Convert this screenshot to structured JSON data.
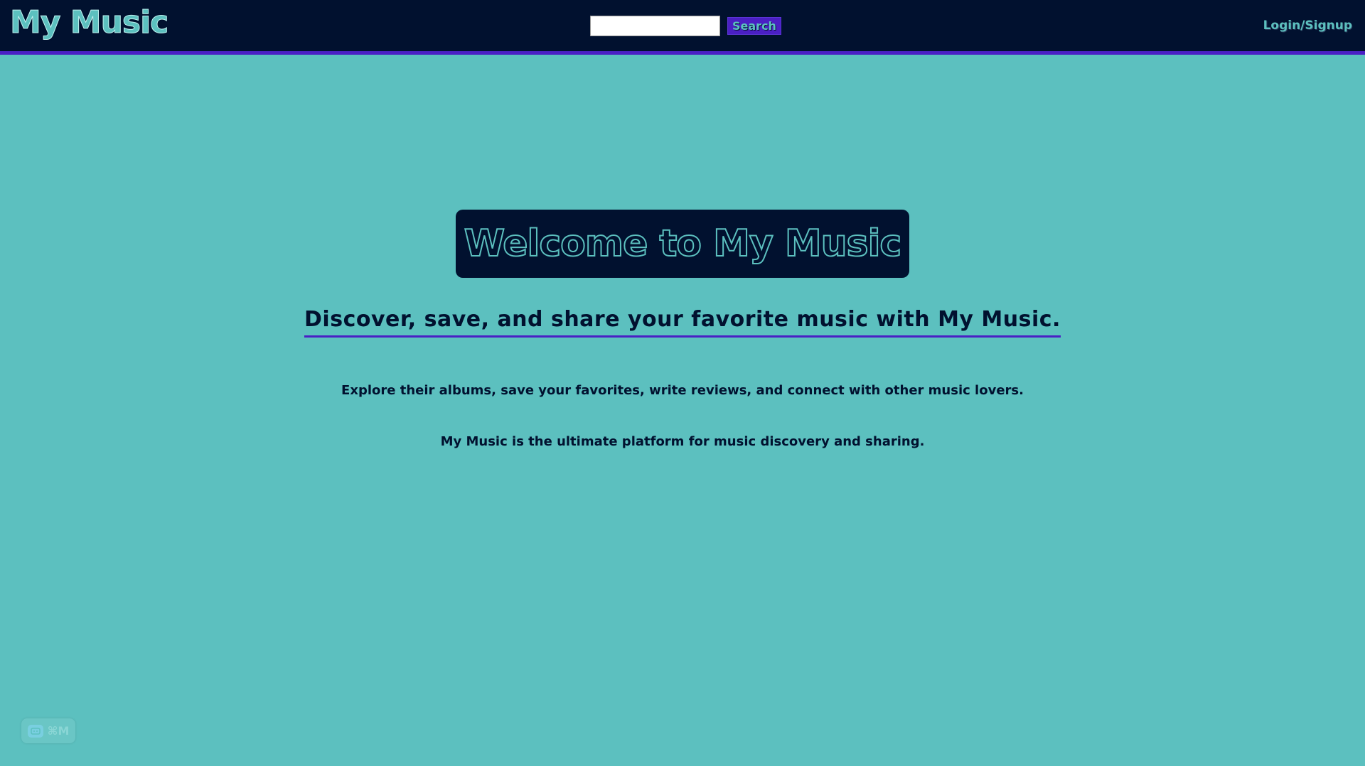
{
  "header": {
    "logo_text": "My Music",
    "search": {
      "value": "",
      "placeholder": "",
      "button_label": "Search"
    },
    "login_label": "Login/Signup"
  },
  "main": {
    "banner_text": "Welcome to My Music",
    "tagline": "Discover, save, and share your favorite music with My Music.",
    "paragraph_1": "Explore their albums, save your favorites, write reviews, and connect with other music lovers.",
    "paragraph_2": "My Music is the ultimate platform for music discovery and sharing."
  },
  "helper_badge": {
    "icon": "assistant-icon",
    "shortcut": "⌘M"
  },
  "colors": {
    "background": "#5cc0bf",
    "navbar": "#01112f",
    "accent": "#4a1fc4",
    "text": "#01112f"
  }
}
